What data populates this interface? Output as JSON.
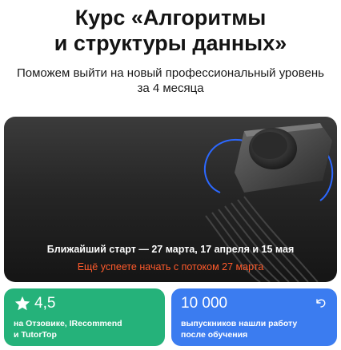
{
  "header": {
    "title_line1": "Курс «Алгоритмы",
    "title_line2": "и структуры данных»",
    "subtitle_line1": "Поможем выйти на новый профессиональный уровень",
    "subtitle_line2": "за 4 месяца"
  },
  "hero": {
    "start_text": "Ближайший старт — 27 марта, 17 апреля и 15 мая",
    "cta_text": "Ещё успеете начать с потоком 27 марта",
    "cta_color": "#ff5a2b"
  },
  "cards": {
    "rating": {
      "icon": "star-icon",
      "value": "4,5",
      "line1": "на Отзовике, IRecommend",
      "line2": "и TutorTop",
      "color": "#25b27a"
    },
    "graduates": {
      "icon": "undo-icon",
      "value": "10 000",
      "line1": "выпускников нашли работу",
      "line2": "после обучения",
      "color": "#3b7cf0"
    }
  }
}
